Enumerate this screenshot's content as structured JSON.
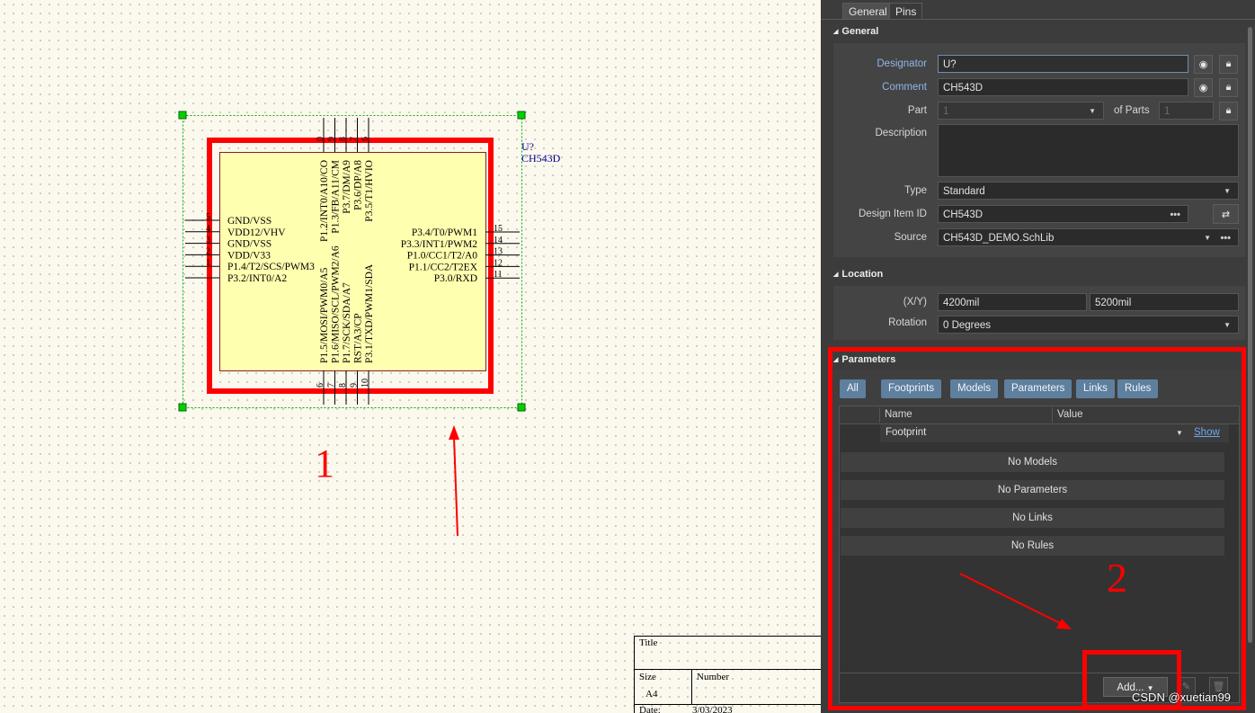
{
  "schematic": {
    "designator": "U?",
    "comment": "CH543D",
    "left_pins": [
      "GND/VSS",
      "VDD12/VHV",
      "GND/VSS",
      "VDD/V33",
      "P1.4/T2/SCS/PWM3",
      "P3.2/INT0/A2"
    ],
    "left_pin_numbers": [
      "5",
      "4",
      "3",
      "2",
      "1",
      ""
    ],
    "right_pins": [
      "P3.4/T0/PWM1",
      "P3.3/INT1/PWM2",
      "P1.0/CC1/T2/A0",
      "P1.1/CC2/T2EX",
      "P3.0/RXD"
    ],
    "right_pin_numbers": [
      "15",
      "14",
      "13",
      "12",
      "11"
    ],
    "top_pins": [
      "P1.2/INT0/A10/CO",
      "P1.3/FB/A11/CM",
      "P3.7/DM/A9",
      "P3.6/DP/A8",
      "P3.5/T1/HVIO"
    ],
    "top_pin_numbers": [
      "0",
      "9",
      "8",
      "7",
      "6"
    ],
    "bottom_pins": [
      "P1.5/MOSI/PWM0/A5",
      "P1.6/MISO/SCL/PWM2/A6",
      "P1.7/SCK/SDA/A7",
      "RST/A3/CP",
      "P3.1/TXD/PWM1/SDA"
    ],
    "bottom_pin_numbers": [
      "6",
      "7",
      "8",
      "9",
      "10"
    ]
  },
  "annotations": {
    "label_1": "1",
    "label_2": "2"
  },
  "title_block": {
    "title_label": "Title",
    "size_label": "Size",
    "size_value": "A4",
    "number_label": "Number",
    "date_label": "Date:",
    "date_value": "3/03/2023"
  },
  "panel": {
    "tabs": [
      "General",
      "Pins"
    ],
    "general": {
      "header": "General",
      "designator_label": "Designator",
      "designator_value": "U?",
      "comment_label": "Comment",
      "comment_value": "CH543D",
      "part_label": "Part",
      "part_value": "1",
      "of_parts_label": "of Parts",
      "of_parts_value": "1",
      "description_label": "Description",
      "description_value": "",
      "type_label": "Type",
      "type_value": "Standard",
      "design_item_label": "Design Item ID",
      "design_item_value": "CH543D",
      "source_label": "Source",
      "source_value": "CH543D_DEMO.SchLib"
    },
    "location": {
      "header": "Location",
      "xy_label": "(X/Y)",
      "x_value": "4200mil",
      "y_value": "5200mil",
      "rotation_label": "Rotation",
      "rotation_value": "0 Degrees"
    },
    "parameters": {
      "header": "Parameters",
      "filters": [
        "All",
        "Footprints",
        "Models",
        "Parameters",
        "Links",
        "Rules"
      ],
      "col_name": "Name",
      "col_value": "Value",
      "footprint_name": "Footprint",
      "show_link": "Show",
      "empty_rows": [
        "No Models",
        "No Parameters",
        "No Links",
        "No Rules"
      ],
      "add_button": "Add..."
    }
  },
  "watermark": "CSDN @xuetian99",
  "colors": {
    "highlight_red": "#ff0000",
    "component_fill": "#ffffb0",
    "selection_green": "#00c800",
    "panel_bg": "#3c3c3c",
    "filter_blue": "#5f7f9f"
  }
}
